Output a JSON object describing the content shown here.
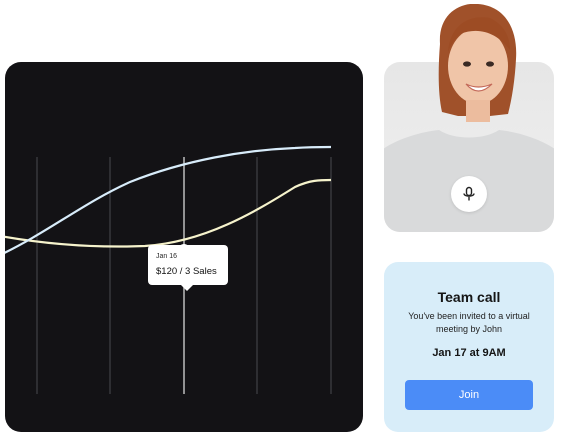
{
  "chart": {
    "tooltip_date": "Jan 16",
    "tooltip_value": "$120 / 3 Sales"
  },
  "video": {
    "mic_icon": "microphone-icon"
  },
  "invite": {
    "title": "Team call",
    "description": "You've been invited to a virtual meeting by John",
    "time": "Jan 17 at 9AM",
    "join_label": "Join"
  },
  "colors": {
    "chart_bg": "#131215",
    "line_blue": "#d8ecfa",
    "line_yellow": "#f6f3cc",
    "invite_bg": "#d8edf9",
    "join_button": "#4b8cf7"
  }
}
